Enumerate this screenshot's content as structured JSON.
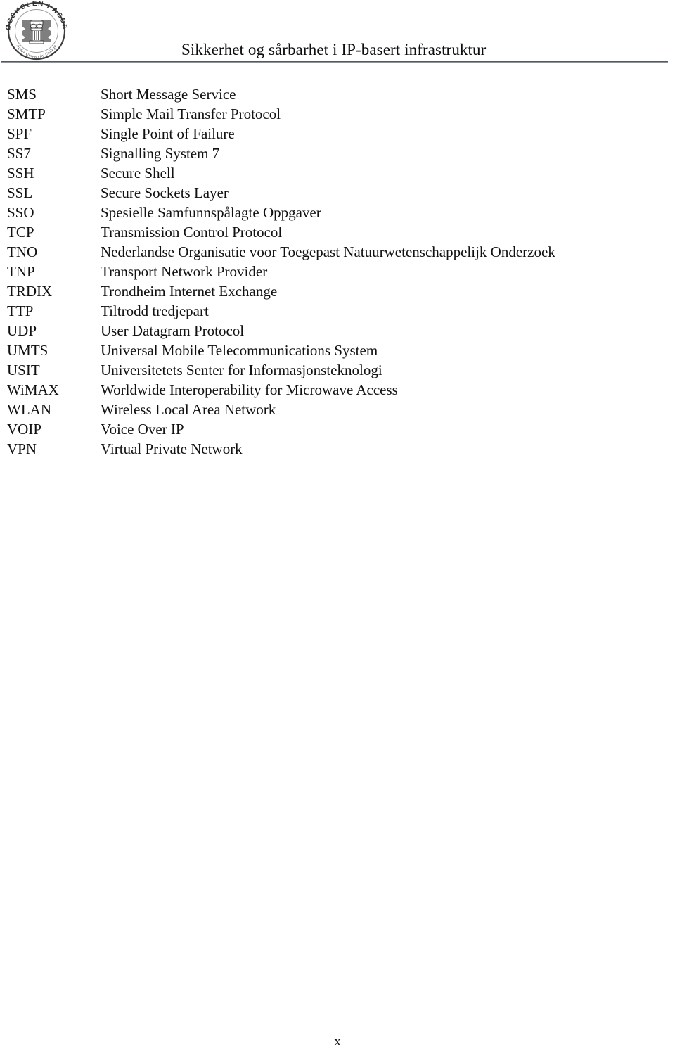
{
  "header": {
    "title": "Sikkerhet og sårbarhet i IP-basert infrastruktur",
    "logo": {
      "ring_text_top": "HØGSKOLEN I AGDER",
      "ring_text_bottom": "Agder University College",
      "icon": "column-seal-icon"
    }
  },
  "abbreviations": [
    {
      "term": "SMS",
      "definition": "Short Message Service"
    },
    {
      "term": "SMTP",
      "definition": "Simple Mail Transfer Protocol"
    },
    {
      "term": "SPF",
      "definition": "Single Point of Failure"
    },
    {
      "term": "SS7",
      "definition": "Signalling System 7"
    },
    {
      "term": "SSH",
      "definition": "Secure Shell"
    },
    {
      "term": "SSL",
      "definition": "Secure Sockets Layer"
    },
    {
      "term": "SSO",
      "definition": "Spesielle Samfunnspålagte Oppgaver"
    },
    {
      "term": "TCP",
      "definition": "Transmission Control Protocol"
    },
    {
      "term": "TNO",
      "definition": "Nederlandse Organisatie voor Toegepast Natuurwetenschappelijk Onderzoek"
    },
    {
      "term": "TNP",
      "definition": "Transport Network Provider"
    },
    {
      "term": "TRDIX",
      "definition": "Trondheim Internet Exchange"
    },
    {
      "term": "TTP",
      "definition": "Tiltrodd tredjepart"
    },
    {
      "term": "UDP",
      "definition": "User Datagram Protocol"
    },
    {
      "term": "UMTS",
      "definition": "Universal Mobile Telecommunications System"
    },
    {
      "term": "USIT",
      "definition": "Universitetets Senter for Informasjonsteknologi"
    },
    {
      "term": "WiMAX",
      "definition": "Worldwide Interoperability for Microwave Access"
    },
    {
      "term": "WLAN",
      "definition": "Wireless Local Area Network"
    },
    {
      "term": "VOIP",
      "definition": "Voice Over IP"
    },
    {
      "term": "VPN",
      "definition": "Virtual Private Network"
    }
  ],
  "footer": {
    "page_number": "x"
  },
  "colors": {
    "text": "#111111",
    "rule": "#57595c",
    "logo_gray": "#7f7f7f"
  }
}
